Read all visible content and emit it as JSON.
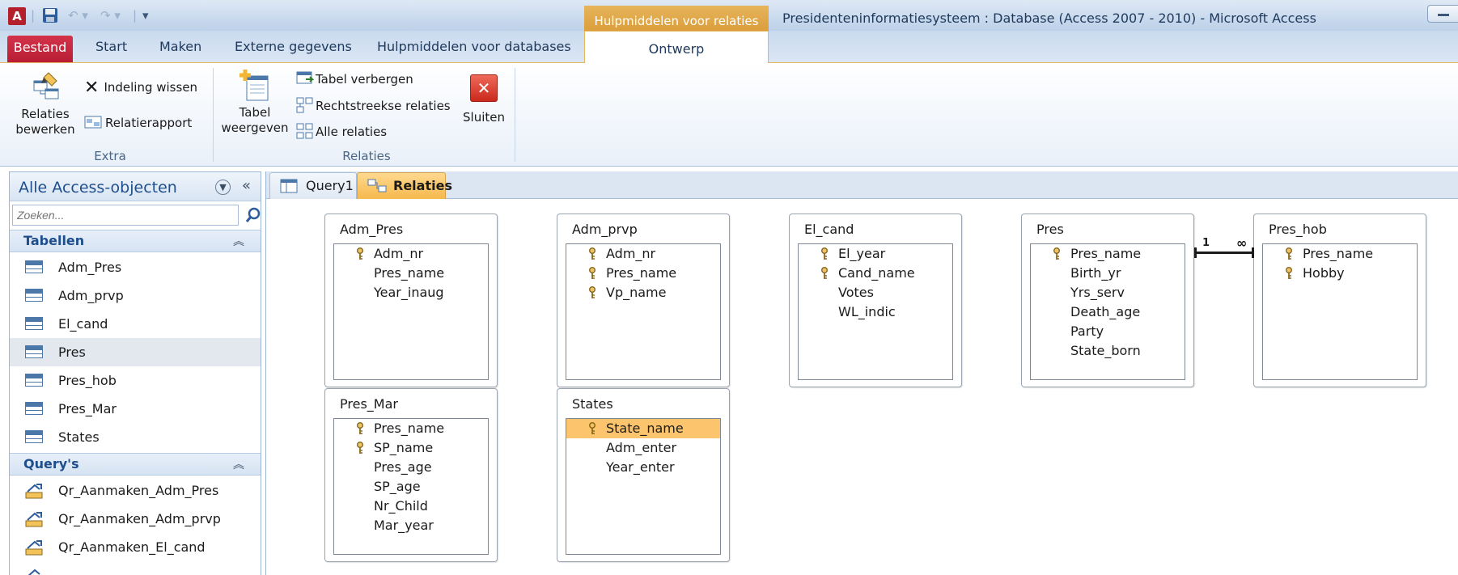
{
  "titlebar": {
    "app_icon_letter": "A",
    "context_tab_title": "Hulpmiddelen voor relaties",
    "window_title": "Presidenteninformatiesysteem : Database (Access 2007 - 2010)  -  Microsoft Access",
    "qat_icons": [
      "save-icon",
      "undo-icon",
      "redo-icon",
      "customize-qat-icon"
    ]
  },
  "ribbon_tabs": {
    "file": "Bestand",
    "start": "Start",
    "create": "Maken",
    "external": "Externe gegevens",
    "dbtools": "Hulpmiddelen voor databases",
    "design": "Ontwerp"
  },
  "ribbon": {
    "extra": {
      "group_label": "Extra",
      "edit_relations": [
        "Relaties",
        "bewerken"
      ],
      "clear_layout": "Indeling wissen",
      "relation_report": "Relatierapport"
    },
    "relaties": {
      "group_label": "Relaties",
      "show_table": [
        "Tabel",
        "weergeven"
      ],
      "hide_table": "Tabel verbergen",
      "direct_relations": "Rechtstreekse relaties",
      "all_relations": "Alle relaties",
      "close": "Sluiten"
    }
  },
  "navpane": {
    "title": "Alle Access-objecten",
    "search_placeholder": "Zoeken...",
    "sections": [
      {
        "label": "Tabellen",
        "items": [
          "Adm_Pres",
          "Adm_prvp",
          "El_cand",
          "Pres",
          "Pres_hob",
          "Pres_Mar",
          "States"
        ],
        "selected": "Pres"
      },
      {
        "label": "Query's",
        "items": [
          "Qr_Aanmaken_Adm_Pres",
          "Qr_Aanmaken_Adm_prvp",
          "Qr_Aanmaken_El_cand"
        ]
      }
    ]
  },
  "doctabs": [
    "Query1",
    "Relaties"
  ],
  "tables": [
    {
      "name": "Adm_Pres",
      "fields": [
        {
          "name": "Adm_nr",
          "key": true
        },
        {
          "name": "Pres_name",
          "key": false
        },
        {
          "name": "Year_inaug",
          "key": false
        }
      ]
    },
    {
      "name": "Adm_prvp",
      "fields": [
        {
          "name": "Adm_nr",
          "key": true
        },
        {
          "name": "Pres_name",
          "key": true
        },
        {
          "name": "Vp_name",
          "key": true
        }
      ]
    },
    {
      "name": "El_cand",
      "fields": [
        {
          "name": "El_year",
          "key": true
        },
        {
          "name": "Cand_name",
          "key": true
        },
        {
          "name": "Votes",
          "key": false
        },
        {
          "name": "WL_indic",
          "key": false
        }
      ]
    },
    {
      "name": "Pres",
      "fields": [
        {
          "name": "Pres_name",
          "key": true
        },
        {
          "name": "Birth_yr",
          "key": false
        },
        {
          "name": "Yrs_serv",
          "key": false
        },
        {
          "name": "Death_age",
          "key": false
        },
        {
          "name": "Party",
          "key": false
        },
        {
          "name": "State_born",
          "key": false
        }
      ]
    },
    {
      "name": "Pres_hob",
      "fields": [
        {
          "name": "Pres_name",
          "key": true
        },
        {
          "name": "Hobby",
          "key": true
        }
      ]
    },
    {
      "name": "Pres_Mar",
      "fields": [
        {
          "name": "Pres_name",
          "key": true
        },
        {
          "name": "SP_name",
          "key": true
        },
        {
          "name": "Pres_age",
          "key": false
        },
        {
          "name": "SP_age",
          "key": false
        },
        {
          "name": "Nr_Child",
          "key": false
        },
        {
          "name": "Mar_year",
          "key": false
        }
      ]
    },
    {
      "name": "States",
      "fields": [
        {
          "name": "State_name",
          "key": true,
          "selected": true
        },
        {
          "name": "Adm_enter",
          "key": false
        },
        {
          "name": "Year_enter",
          "key": false
        }
      ]
    }
  ],
  "relationship": {
    "from": "Pres.Pres_name",
    "to": "Pres_hob.Pres_name",
    "one_label": "1",
    "many_label": "∞"
  },
  "colors": {
    "accent_orange": "#f5b94c",
    "file_tab": "#c22a3f",
    "nav_title": "#1e4e8c"
  }
}
